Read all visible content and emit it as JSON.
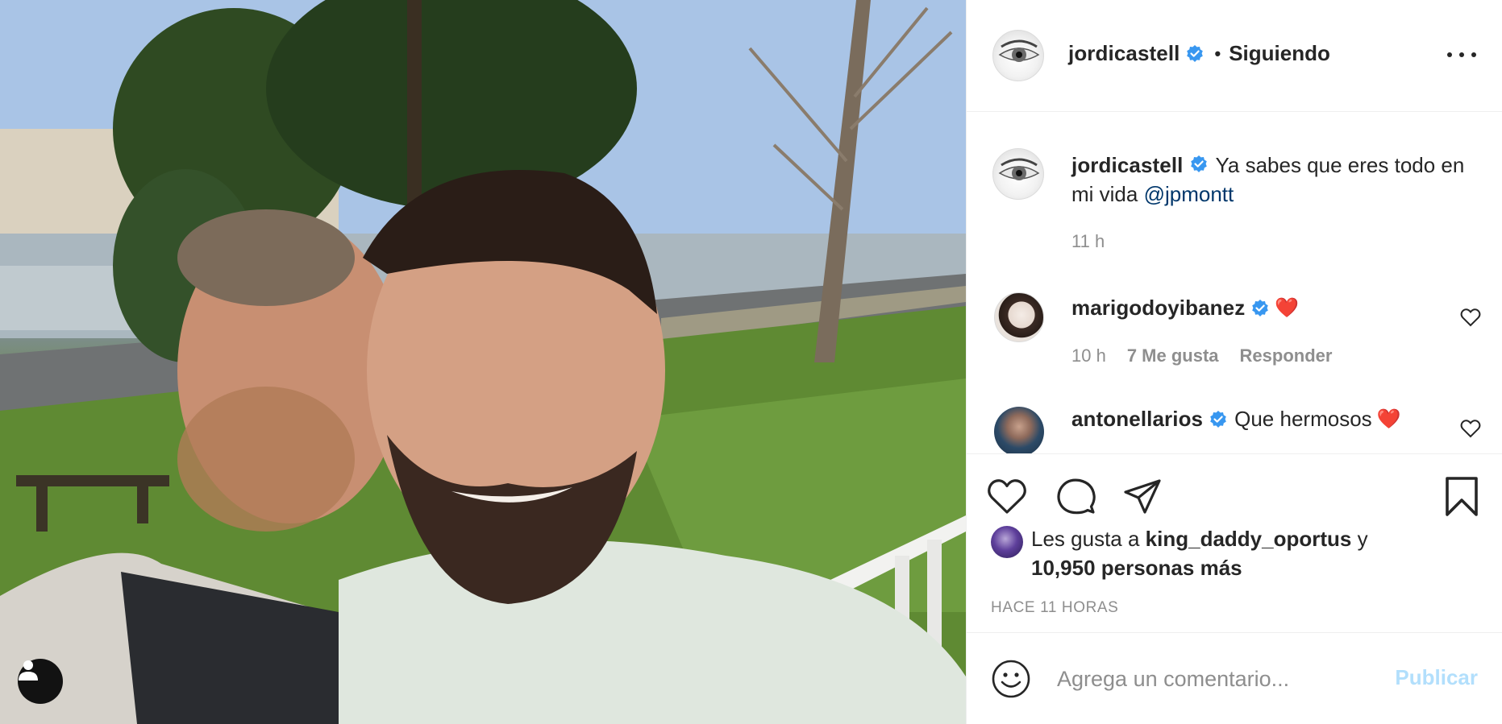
{
  "post": {
    "author": "jordicastell",
    "follow_status": "Siguiendo",
    "separator": "•",
    "caption_text": "Ya sabes que eres todo en mi vida",
    "caption_mention": "@jpmontt",
    "caption_time": "11 h"
  },
  "comments": [
    {
      "username": "marigodoyibanez",
      "text": "",
      "emoji": "❤️",
      "time": "10 h",
      "likes": "7 Me gusta",
      "reply": "Responder"
    },
    {
      "username": "antonellarios",
      "text": "Que hermosos",
      "emoji": "❤️"
    }
  ],
  "likes": {
    "prefix": "Les gusta a",
    "first_liker": "king_daddy_oportus",
    "joiner": "y",
    "others": "10,950 personas más"
  },
  "timestamp": "HACE 11 HORAS",
  "comment_box": {
    "placeholder": "Agrega un comentario...",
    "publish_label": "Publicar"
  },
  "icons": {
    "verified": "verified-badge-icon",
    "more": "more-options-icon",
    "like": "heart-icon",
    "comment": "comment-icon",
    "share": "send-icon",
    "save": "bookmark-icon",
    "emoji": "emoji-icon",
    "user_tag": "user-tag-icon"
  },
  "colors": {
    "text": "#262626",
    "secondary": "#8e8e8e",
    "verified": "#3897f0",
    "mention": "#00376b",
    "publish_disabled": "#b2dffc"
  }
}
